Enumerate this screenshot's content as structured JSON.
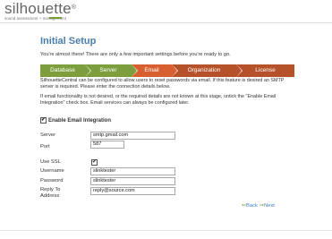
{
  "brand": {
    "name": "silhouette",
    "mark": "®",
    "tagline": "sound assessment + management",
    "accent": "#7a9b3a"
  },
  "page": {
    "title": "Initial Setup",
    "intro": "You're almost there! There are only a few important settings before you're ready to go."
  },
  "steps": [
    {
      "label": "Database",
      "state": "done"
    },
    {
      "label": "Server",
      "state": "done"
    },
    {
      "label": "Email",
      "state": "current"
    },
    {
      "label": "Organization",
      "state": "todo"
    },
    {
      "label": "License",
      "state": "todo"
    }
  ],
  "colors": {
    "step_done": "#7d9e3d",
    "step_current": "#d85f2f",
    "step_todo": "#b6522a",
    "title": "#4a7eb0",
    "link": "#3a7fc4"
  },
  "description": {
    "p1": "SilhouetteCentral can be configured to allow users to reset passwords via email. If this feature is desired an SMTP server is required. Please enter the connection details below.",
    "p2": "If email functionality is not desired, or the required details are not known at this stage, untick the \"Enable Email Integration\" check box. Email services can always be configured later."
  },
  "enable_email": {
    "label": "Enable Email Integration",
    "checked": true,
    "check_glyph": "✔"
  },
  "form": {
    "server": {
      "label": "Server",
      "value": "smtp.gmail.com"
    },
    "port": {
      "label": "Port",
      "value": "587"
    },
    "use_ssl": {
      "label": "Use SSL",
      "checked": true,
      "check_glyph": "✔"
    },
    "username": {
      "label": "Username",
      "value": "slinktester"
    },
    "password": {
      "label": "Password",
      "value": "slinktester"
    },
    "reply_to": {
      "label": "Reply To Address",
      "value": "reply@source.com"
    }
  },
  "nav": {
    "back_arrow": "⇐",
    "back_label": "Back",
    "next_arrow": "⇒",
    "next_label": "Next"
  }
}
